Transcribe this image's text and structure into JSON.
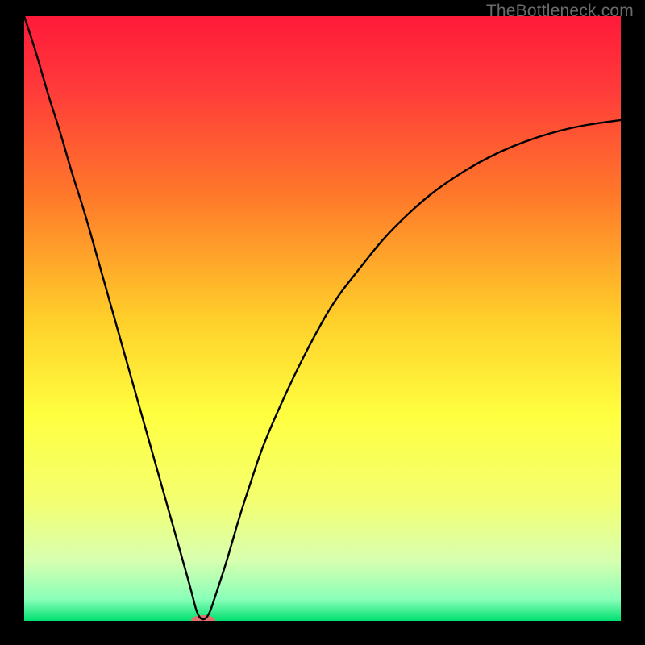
{
  "watermark": "TheBottleneck.com",
  "chart_data": {
    "type": "line",
    "title": "",
    "xlabel": "",
    "ylabel": "",
    "xlim": [
      0,
      100
    ],
    "ylim": [
      0,
      100
    ],
    "grid": false,
    "legend": false,
    "background_gradient": {
      "stops": [
        {
          "offset": 0.0,
          "color": "#ff1a3a"
        },
        {
          "offset": 0.12,
          "color": "#ff3a3a"
        },
        {
          "offset": 0.3,
          "color": "#ff7a2a"
        },
        {
          "offset": 0.5,
          "color": "#ffcf2a"
        },
        {
          "offset": 0.66,
          "color": "#ffff40"
        },
        {
          "offset": 0.8,
          "color": "#f4ff70"
        },
        {
          "offset": 0.9,
          "color": "#d8ffb0"
        },
        {
          "offset": 0.965,
          "color": "#88ffb8"
        },
        {
          "offset": 1.0,
          "color": "#00e070"
        }
      ]
    },
    "series": [
      {
        "name": "bottleneck-curve",
        "x": [
          0,
          2,
          4,
          6,
          8,
          10,
          12,
          14,
          16,
          18,
          20,
          22,
          24,
          26,
          28,
          29,
          30,
          31,
          32,
          34,
          36,
          38,
          40,
          44,
          48,
          52,
          56,
          60,
          64,
          68,
          72,
          76,
          80,
          84,
          88,
          92,
          96,
          100
        ],
        "y": [
          100,
          94,
          87,
          81,
          74,
          68,
          61,
          54,
          47,
          40,
          33,
          26,
          19,
          12,
          5,
          1,
          0,
          1,
          4,
          10,
          17,
          23,
          29,
          38,
          46,
          53,
          58,
          63,
          67,
          70.5,
          73.3,
          75.7,
          77.7,
          79.3,
          80.6,
          81.6,
          82.3,
          82.8
        ]
      }
    ],
    "marker": {
      "name": "minimum-marker",
      "x": 30,
      "y": 0,
      "color": "#e36f6b",
      "rx": 15,
      "ry": 7
    }
  }
}
